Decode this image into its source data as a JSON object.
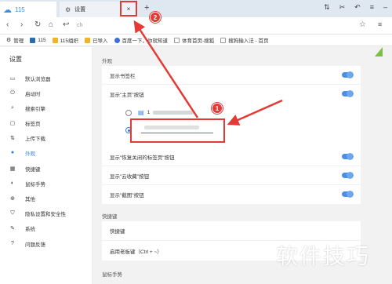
{
  "tabs": [
    {
      "label": "115",
      "icon": "cloud-icon"
    },
    {
      "label": "设置",
      "icon": "gear-icon"
    }
  ],
  "new_tab_symbol": "+",
  "tab_close_symbol": "×",
  "url": "ch",
  "bookmarks": [
    {
      "label": "管理",
      "icon": "gear-icon"
    },
    {
      "label": "115",
      "icon": "s-logo-icon"
    },
    {
      "label": "115组织",
      "icon": "folder-icon"
    },
    {
      "label": "已导入",
      "icon": "folder-icon"
    },
    {
      "label": "百度一下，你就知道",
      "icon": "baidu-icon"
    },
    {
      "label": "体育首页-搜狐",
      "icon": "page-icon"
    },
    {
      "label": "搜狗输入法 - 首页",
      "icon": "page-icon"
    }
  ],
  "sidebar": {
    "title": "设置",
    "items": [
      {
        "label": "默认浏览器",
        "icon": "browser-icon"
      },
      {
        "label": "启动时",
        "icon": "power-icon"
      },
      {
        "label": "搜索引擎",
        "icon": "search-icon"
      },
      {
        "label": "标签页",
        "icon": "tab-icon"
      },
      {
        "label": "上传下载",
        "icon": "transfer-icon"
      },
      {
        "label": "外观",
        "icon": "palette-icon",
        "active": true
      },
      {
        "label": "快捷键",
        "icon": "keyboard-icon"
      },
      {
        "label": "鼠标手势",
        "icon": "mouse-icon"
      },
      {
        "label": "其他",
        "icon": "plus-icon"
      },
      {
        "label": "隐私设置和安全性",
        "icon": "shield-icon"
      },
      {
        "label": "系统",
        "icon": "wrench-icon"
      },
      {
        "label": "问题反馈",
        "icon": "question-icon"
      }
    ]
  },
  "main": {
    "appearance": {
      "title": "外观",
      "show_bookmarks": "显示书签栏",
      "show_home_button": "显示\"主页\"按钮",
      "home_option_1": "1",
      "show_reopen_tab": "显示\"恢复关闭的标签页\"按钮",
      "show_cloud_favorites": "显示\"云收藏\"按钮",
      "show_screenshot": "显示\"截图\"按钮"
    },
    "shortcuts": {
      "title": "快捷键",
      "row_shortcut": "快捷键",
      "row_boss_key": "启用老板键（Ctrl + ~）"
    },
    "mouse_gesture_title": "鼠标手势"
  },
  "annotations": {
    "badge_1": "1",
    "badge_2": "2",
    "color": "#e53935"
  },
  "watermark": "软件技巧",
  "accent_color": "#2f7de1"
}
